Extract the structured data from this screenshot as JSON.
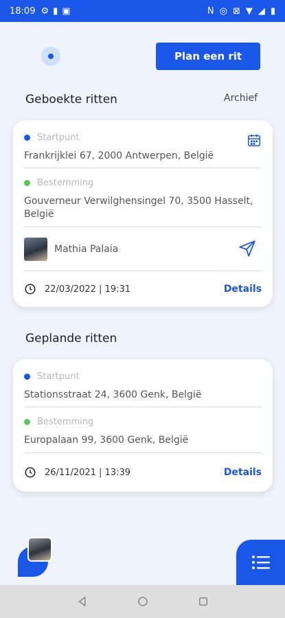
{
  "status": {
    "time": "18:09"
  },
  "header": {
    "plan_label": "Plan een rit"
  },
  "booked": {
    "title": "Geboekte ritten",
    "archive_label": "Archief",
    "card": {
      "start_label": "Startpunt",
      "start_address": "Frankrijklei 67, 2000 Antwerpen, België",
      "dest_label": "Bestemming",
      "dest_address": "Gouverneur Verwilghensingel 70, 3500 Hasselt, België",
      "driver_name": "Mathia Palaia",
      "datetime": "22/03/2022 | 19:31",
      "details_label": "Details"
    }
  },
  "planned": {
    "title": "Geplande ritten",
    "card": {
      "start_label": "Startpunt",
      "start_address": "Stationsstraat 24, 3600 Genk, België",
      "dest_label": "Bestemming",
      "dest_address": "Europalaan 99, 3600 Genk, België",
      "datetime": "26/11/2021 | 13:39",
      "details_label": "Details"
    }
  },
  "colors": {
    "accent": "#1a56e8",
    "dest_dot": "#5fc25b",
    "background": "#eef3fc"
  }
}
